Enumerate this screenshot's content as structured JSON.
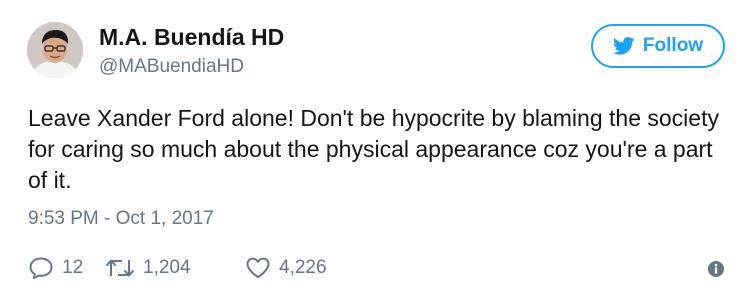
{
  "tweet": {
    "display_name": "M.A. Buendía HD",
    "handle": "@MABuendiaHD",
    "text": "Leave Xander Ford alone! Don't be hypocrite by blaming the society for caring so much about the physical appearance coz you're a part of it.",
    "timestamp": "9:53 PM - Oct 1, 2017"
  },
  "follow_button": {
    "label": "Follow",
    "icon": "twitter-bird-icon"
  },
  "actions": {
    "replies": "12",
    "retweets": "1,204",
    "likes": "4,226"
  },
  "icons": {
    "reply": "reply-icon",
    "retweet": "retweet-icon",
    "like": "heart-icon",
    "info": "info-icon"
  },
  "colors": {
    "accent": "#1da1f2",
    "text": "#14171a",
    "secondary": "#657786"
  }
}
